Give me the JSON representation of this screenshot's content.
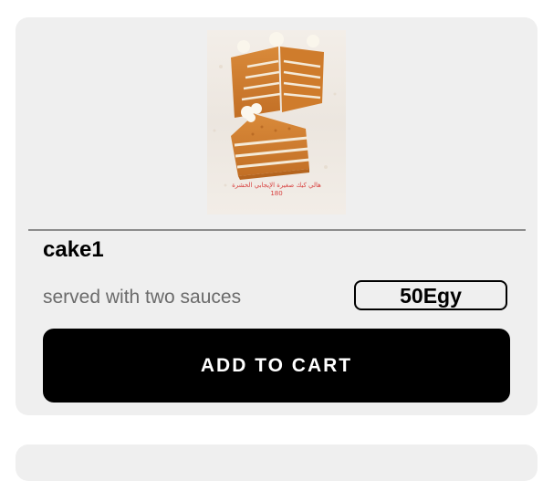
{
  "product": {
    "title": "cake1",
    "description": "served with two sauces",
    "price": "50Egy",
    "add_button_label": "ADD TO CART",
    "image_caption_line1": "هالي كيك صغيرة الإيجابي الخشرة",
    "image_caption_line2": "180"
  },
  "colors": {
    "card_background": "#efefef",
    "button_background": "#000000",
    "button_text": "#ffffff",
    "description_text": "#6b6b6b"
  }
}
